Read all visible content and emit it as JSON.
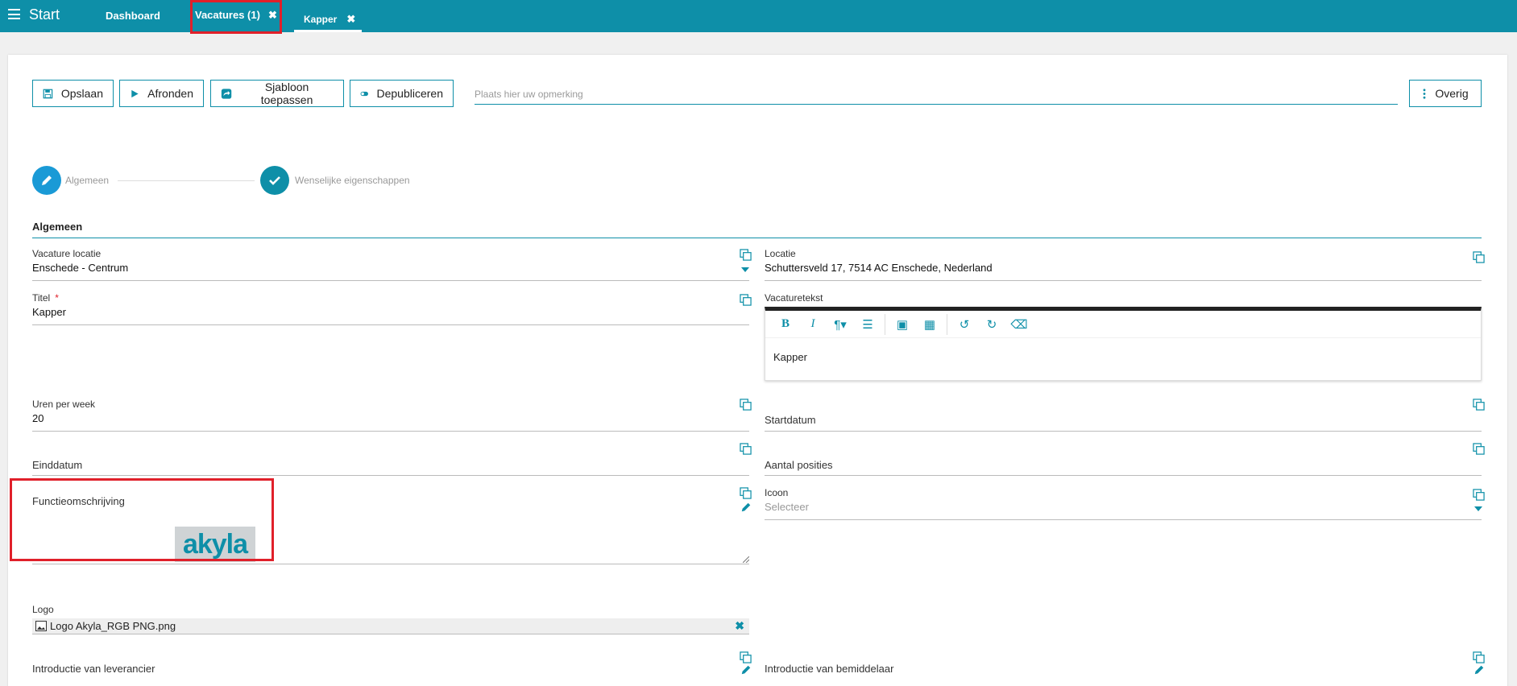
{
  "topbar": {
    "start_label": "Start",
    "tabs": [
      {
        "label": "Dashboard"
      },
      {
        "label": "Vacatures (1)",
        "close": "✖"
      },
      {
        "label": "Kapper",
        "close": "✖"
      }
    ]
  },
  "toolbar": {
    "save": "Opslaan",
    "finish": "Afronden",
    "template": "Sjabloon toepassen",
    "depublish": "Depubliceren",
    "remark_placeholder": "Plaats hier uw opmerking",
    "more": "Overig"
  },
  "stepper": {
    "steps": [
      {
        "label": "Algemeen"
      },
      {
        "label": "Wenselijke eigenschappen"
      }
    ]
  },
  "section": {
    "title": "Algemeen"
  },
  "fields": {
    "vacature_locatie": {
      "label": "Vacature locatie",
      "value": "Enschede - Centrum"
    },
    "locatie": {
      "label": "Locatie",
      "value": "Schuttersveld 17, 7514 AC Enschede, Nederland"
    },
    "titel": {
      "label": "Titel",
      "required": "*",
      "value": "Kapper"
    },
    "vacaturetekst": {
      "label": "Vacaturetekst",
      "content": "Kapper"
    },
    "uren": {
      "label": "Uren per week",
      "value": "20"
    },
    "startdatum": {
      "label": "Startdatum"
    },
    "einddatum": {
      "label": "Einddatum"
    },
    "aantal_posities": {
      "label": "Aantal posities"
    },
    "functieomschrijving": {
      "label": "Functieomschrijving"
    },
    "icoon": {
      "label": "Icoon",
      "placeholder": "Selecteer"
    },
    "logo": {
      "label": "Logo",
      "filename": "Logo Akyla_RGB PNG.png",
      "logo_text": "akyla"
    },
    "intro_leverancier": {
      "label": "Introductie van leverancier"
    },
    "intro_bemiddelaar": {
      "label": "Introductie van bemiddelaar"
    }
  },
  "colors": {
    "accent": "#0e8fa8",
    "highlight": "#e0202a",
    "step_active": "#1a9ad6"
  }
}
